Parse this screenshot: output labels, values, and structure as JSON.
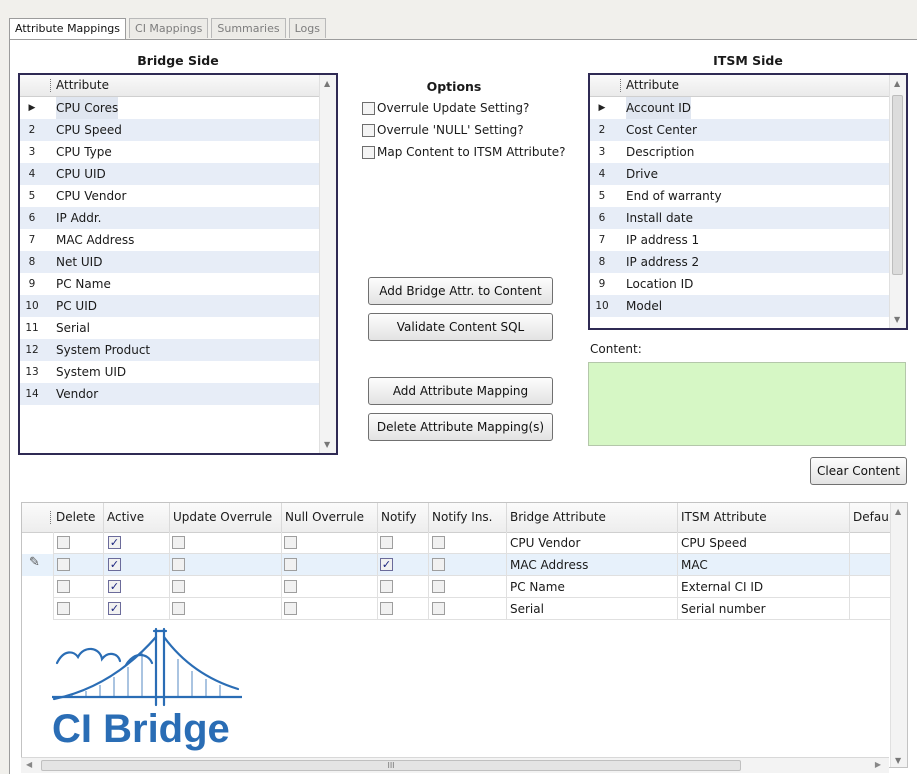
{
  "tabs": [
    "Attribute Mappings",
    "CI Mappings",
    "Summaries",
    "Logs"
  ],
  "bridge_side": {
    "title": "Bridge Side",
    "header": "Attribute",
    "rows": [
      "CPU Cores",
      "CPU Speed",
      "CPU Type",
      "CPU UID",
      "CPU Vendor",
      "IP Addr.",
      "MAC Address",
      "Net UID",
      "PC Name",
      "PC UID",
      "Serial",
      "System Product",
      "System UID",
      "Vendor"
    ],
    "row_numbers": [
      "",
      "2",
      "3",
      "4",
      "5",
      "6",
      "7",
      "8",
      "9",
      "10",
      "11",
      "12",
      "13",
      "14"
    ]
  },
  "itsm_side": {
    "title": "ITSM Side",
    "header": "Attribute",
    "rows": [
      "Account ID",
      "Cost Center",
      "Description",
      "Drive",
      "End of warranty",
      "Install date",
      "IP address 1",
      "IP address 2",
      "Location ID",
      "Model"
    ],
    "row_numbers": [
      "",
      "2",
      "3",
      "4",
      "5",
      "6",
      "7",
      "8",
      "9",
      "10"
    ]
  },
  "options": {
    "title": "Options",
    "items": [
      "Overrule Update Setting?",
      "Overrule 'NULL' Setting?",
      "Map Content to ITSM Attribute?"
    ]
  },
  "buttons": {
    "add_bridge_attr": "Add Bridge Attr. to Content",
    "validate_sql": "Validate Content SQL",
    "add_mapping": "Add Attribute Mapping",
    "delete_mapping": "Delete Attribute Mapping(s)",
    "clear_content": "Clear Content"
  },
  "content_label": "Content:",
  "grid": {
    "columns": [
      "Delete",
      "Active",
      "Update Overrule",
      "Null Overrule",
      "Notify",
      "Notify Ins.",
      "Bridge Attribute",
      "ITSM Attribute",
      "Defau"
    ],
    "rows": [
      {
        "delete": false,
        "active": true,
        "update_overrule": false,
        "null_overrule": false,
        "notify": false,
        "notify_ins": false,
        "bridge": "CPU Vendor",
        "itsm": "CPU Speed"
      },
      {
        "delete": false,
        "active": true,
        "update_overrule": false,
        "null_overrule": false,
        "notify": true,
        "notify_ins": false,
        "bridge": "MAC Address",
        "itsm": "MAC"
      },
      {
        "delete": false,
        "active": true,
        "update_overrule": false,
        "null_overrule": false,
        "notify": false,
        "notify_ins": false,
        "bridge": "PC Name",
        "itsm": "External CI ID"
      },
      {
        "delete": false,
        "active": true,
        "update_overrule": false,
        "null_overrule": false,
        "notify": false,
        "notify_ins": false,
        "bridge": "Serial",
        "itsm": "Serial number"
      }
    ]
  },
  "hscroll_grip": "III",
  "logo": {
    "text": "CI Bridge",
    "color": "#2a6db5"
  },
  "colors": {
    "list_border": "#2f2a54",
    "content_bg": "#d6f7c5",
    "row_alt": "#e7edf7",
    "selected_row": "#e7f1fb"
  }
}
